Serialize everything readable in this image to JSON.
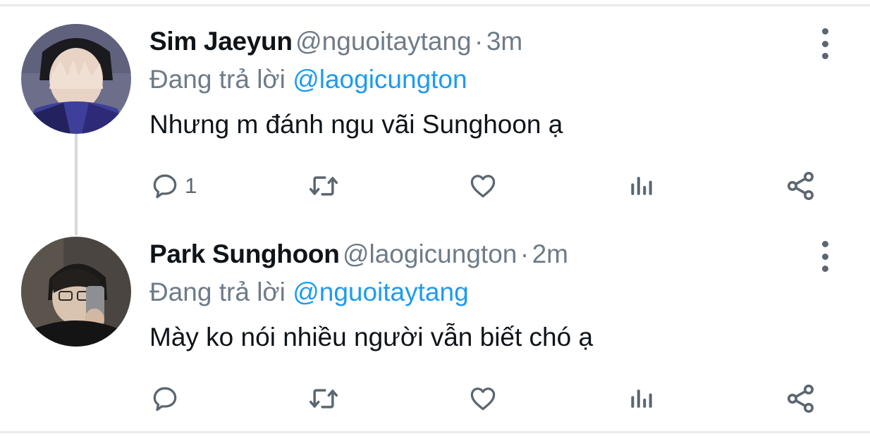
{
  "tweets": [
    {
      "name": "Sim Jaeyun",
      "handle": "@nguoitaytang",
      "separator": "·",
      "time": "3m",
      "reply_prefix": "Đang trả lời",
      "reply_to": "@laogicungton",
      "text": "Nhưng m đánh ngu vãi Sunghoon ạ",
      "reply_count": "1",
      "icons": [
        "reply-icon",
        "retweet-icon",
        "like-icon",
        "views-icon",
        "share-icon",
        "more-icon"
      ]
    },
    {
      "name": "Park Sunghoon",
      "handle": "@laogicungton",
      "separator": "·",
      "time": "2m",
      "reply_prefix": "Đang trả lời",
      "reply_to": "@nguoitaytang",
      "text": "Mày ko nói nhiều người vẫn biết chó ạ",
      "reply_count": "",
      "icons": [
        "reply-icon",
        "retweet-icon",
        "like-icon",
        "views-icon",
        "share-icon",
        "more-icon"
      ]
    }
  ],
  "colors": {
    "name": "#0f1419",
    "secondary_text": "#6e7b88",
    "mention": "#1d9bf0",
    "icon": "#5b6670",
    "divider": "#e8eaed",
    "thread_line": "#d4d7db"
  }
}
